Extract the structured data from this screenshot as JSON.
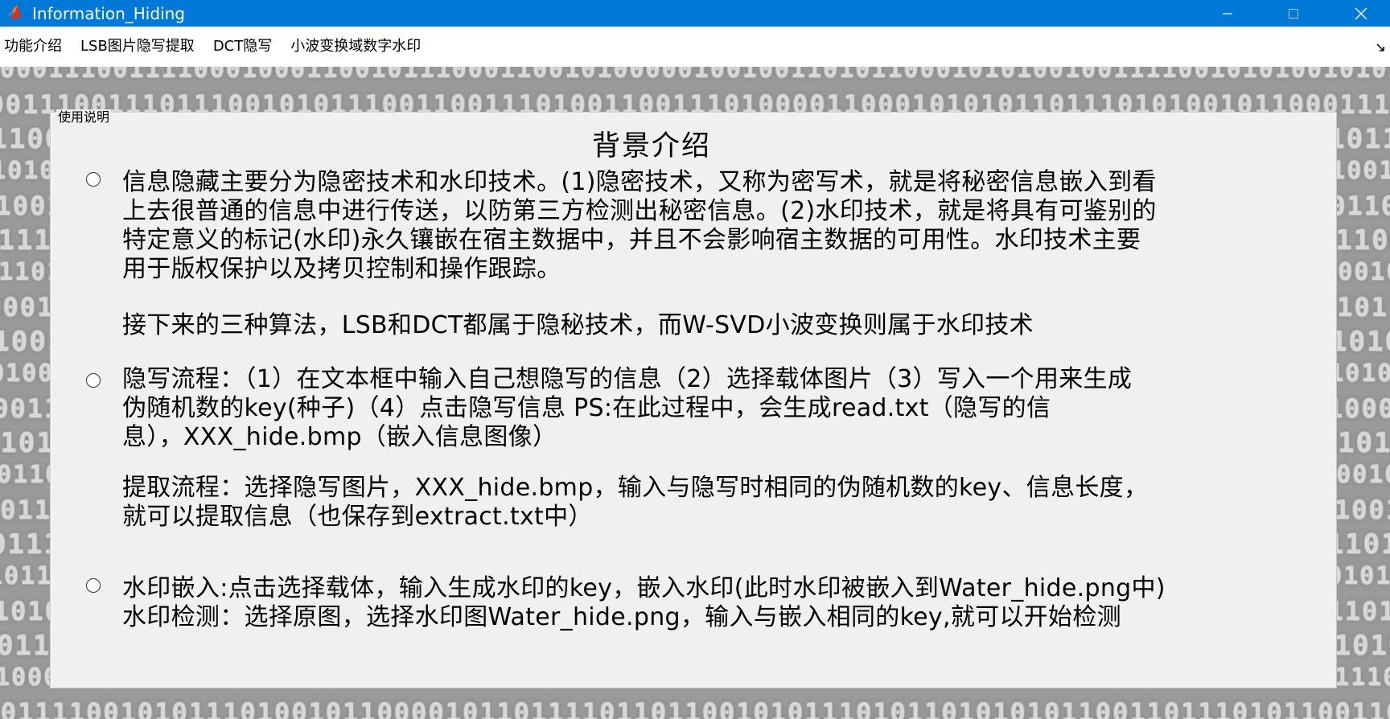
{
  "window": {
    "title": "Information_Hiding"
  },
  "menu": {
    "items": [
      {
        "label": "功能介绍"
      },
      {
        "label": "LSB图片隐写提取"
      },
      {
        "label": "DCT隐写"
      },
      {
        "label": "小波变换域数字水印"
      }
    ]
  },
  "panel": {
    "title": "使用说明",
    "heading": "背景介绍",
    "sections": [
      {
        "lines": [
          "信息隐藏主要分为隐密技术和水印技术。(1)隐密技术，又称为密写术，就是将秘密信息嵌入到看",
          "上去很普通的信息中进行传送，以防第三方检测出秘密信息。(2)水印技术，就是将具有可鉴别的",
          "特定意义的标记(水印)永久镶嵌在宿主数据中，并且不会影响宿主数据的可用性。水印技术主要",
          "用于版权保护以及拷贝控制和操作跟踪。"
        ],
        "note": "接下来的三种算法，LSB和DCT都属于隐秘技术，而W-SVD小波变换则属于水印技术"
      },
      {
        "lines": [
          "隐写流程：（1）在文本框中输入自己想隐写的信息（2）选择载体图片（3）写入一个用来生成",
          "伪随机数的key(种子)（4）点击隐写信息 PS:在此过程中，会生成read.txt（隐写的信",
          "息），XXX_hide.bmp（嵌入信息图像）"
        ],
        "note_lines": [
          "提取流程：选择隐写图片，XXX_hide.bmp，输入与隐写时相同的伪随机数的key、信息长度，",
          "就可以提取信息（也保存到extract.txt中）"
        ]
      },
      {
        "lines": [
          "水印嵌入:点击选择载体，输入生成水印的key，嵌入水印(此时水印被嵌入到Water_hide.png中)",
          "水印检测：选择原图，选择水印图Water_hide.png，输入与嵌入相同的key,就可以开始检测"
        ]
      }
    ]
  },
  "background_binary": [
    "10001110011110001000110010111000110010100000100100110101100010101001001111001010100101010011001001",
    "00001110011101110010101110011001110100110011101000011000101010110111010100101100011100110111001010",
    "11100101010000111101011001010101101110111101001111011001010011010011110000110110100110011100010101",
    "00110101111001110010001110010101010010101010100101111010111000111101010001011110100101100101100111",
    "10100101100111011001010110111011001110100111000110100011101010010100010101011100011010101101011001",
    "01110011011011000010110011101101001011010100110011101001010001011101011101011001100111011000110101",
    "10111011000110100011011101101011100101100101101100110101011100011001101100101011101001001011010101",
    "00001110100101100111100100110100101101011100010111011010001011000101011001000111101110110101000010",
    "01110011011111000101010011001010001101101110010110100011110101011100101100001101010111010100110100",
    "11010011001010010100111001010111001011101010010101101001110001010110011101011001101111010101011100",
    "10011010110011010100011101001010111101101011000111010101000101100101110101010111000101010111010110",
    "01110110010111010100101111001010101110101011100101101011101001011011001010110101011010110001001101",
    "01011000101101100101110010101100111010011011010101100110101011100101101101100111000110010111010101",
    "10110101011000111010111010100101100110101001011010111010010110101010001101101011001110101011100010",
    "00011101010010110101101011100101011101011010110100101011011010110101110101001101011001011101010101",
    "11011100100111010001101111001101000111011001110001011010100011011100110100011011001101011010011001",
    "01010101100101001100100110110001110101100011011100011101101100010111011100001000111011001110001011",
    "10011110101001110110100010011001101011010001111001011101000111000110100111011010101010110010101010",
    "01000110011110100101000111010110111101010111011010111101100111110101101011111011111011101110110011",
    "00101111001010111010010110000101101111011011001010111010110101010110011011101011001101001110101110"
  ]
}
